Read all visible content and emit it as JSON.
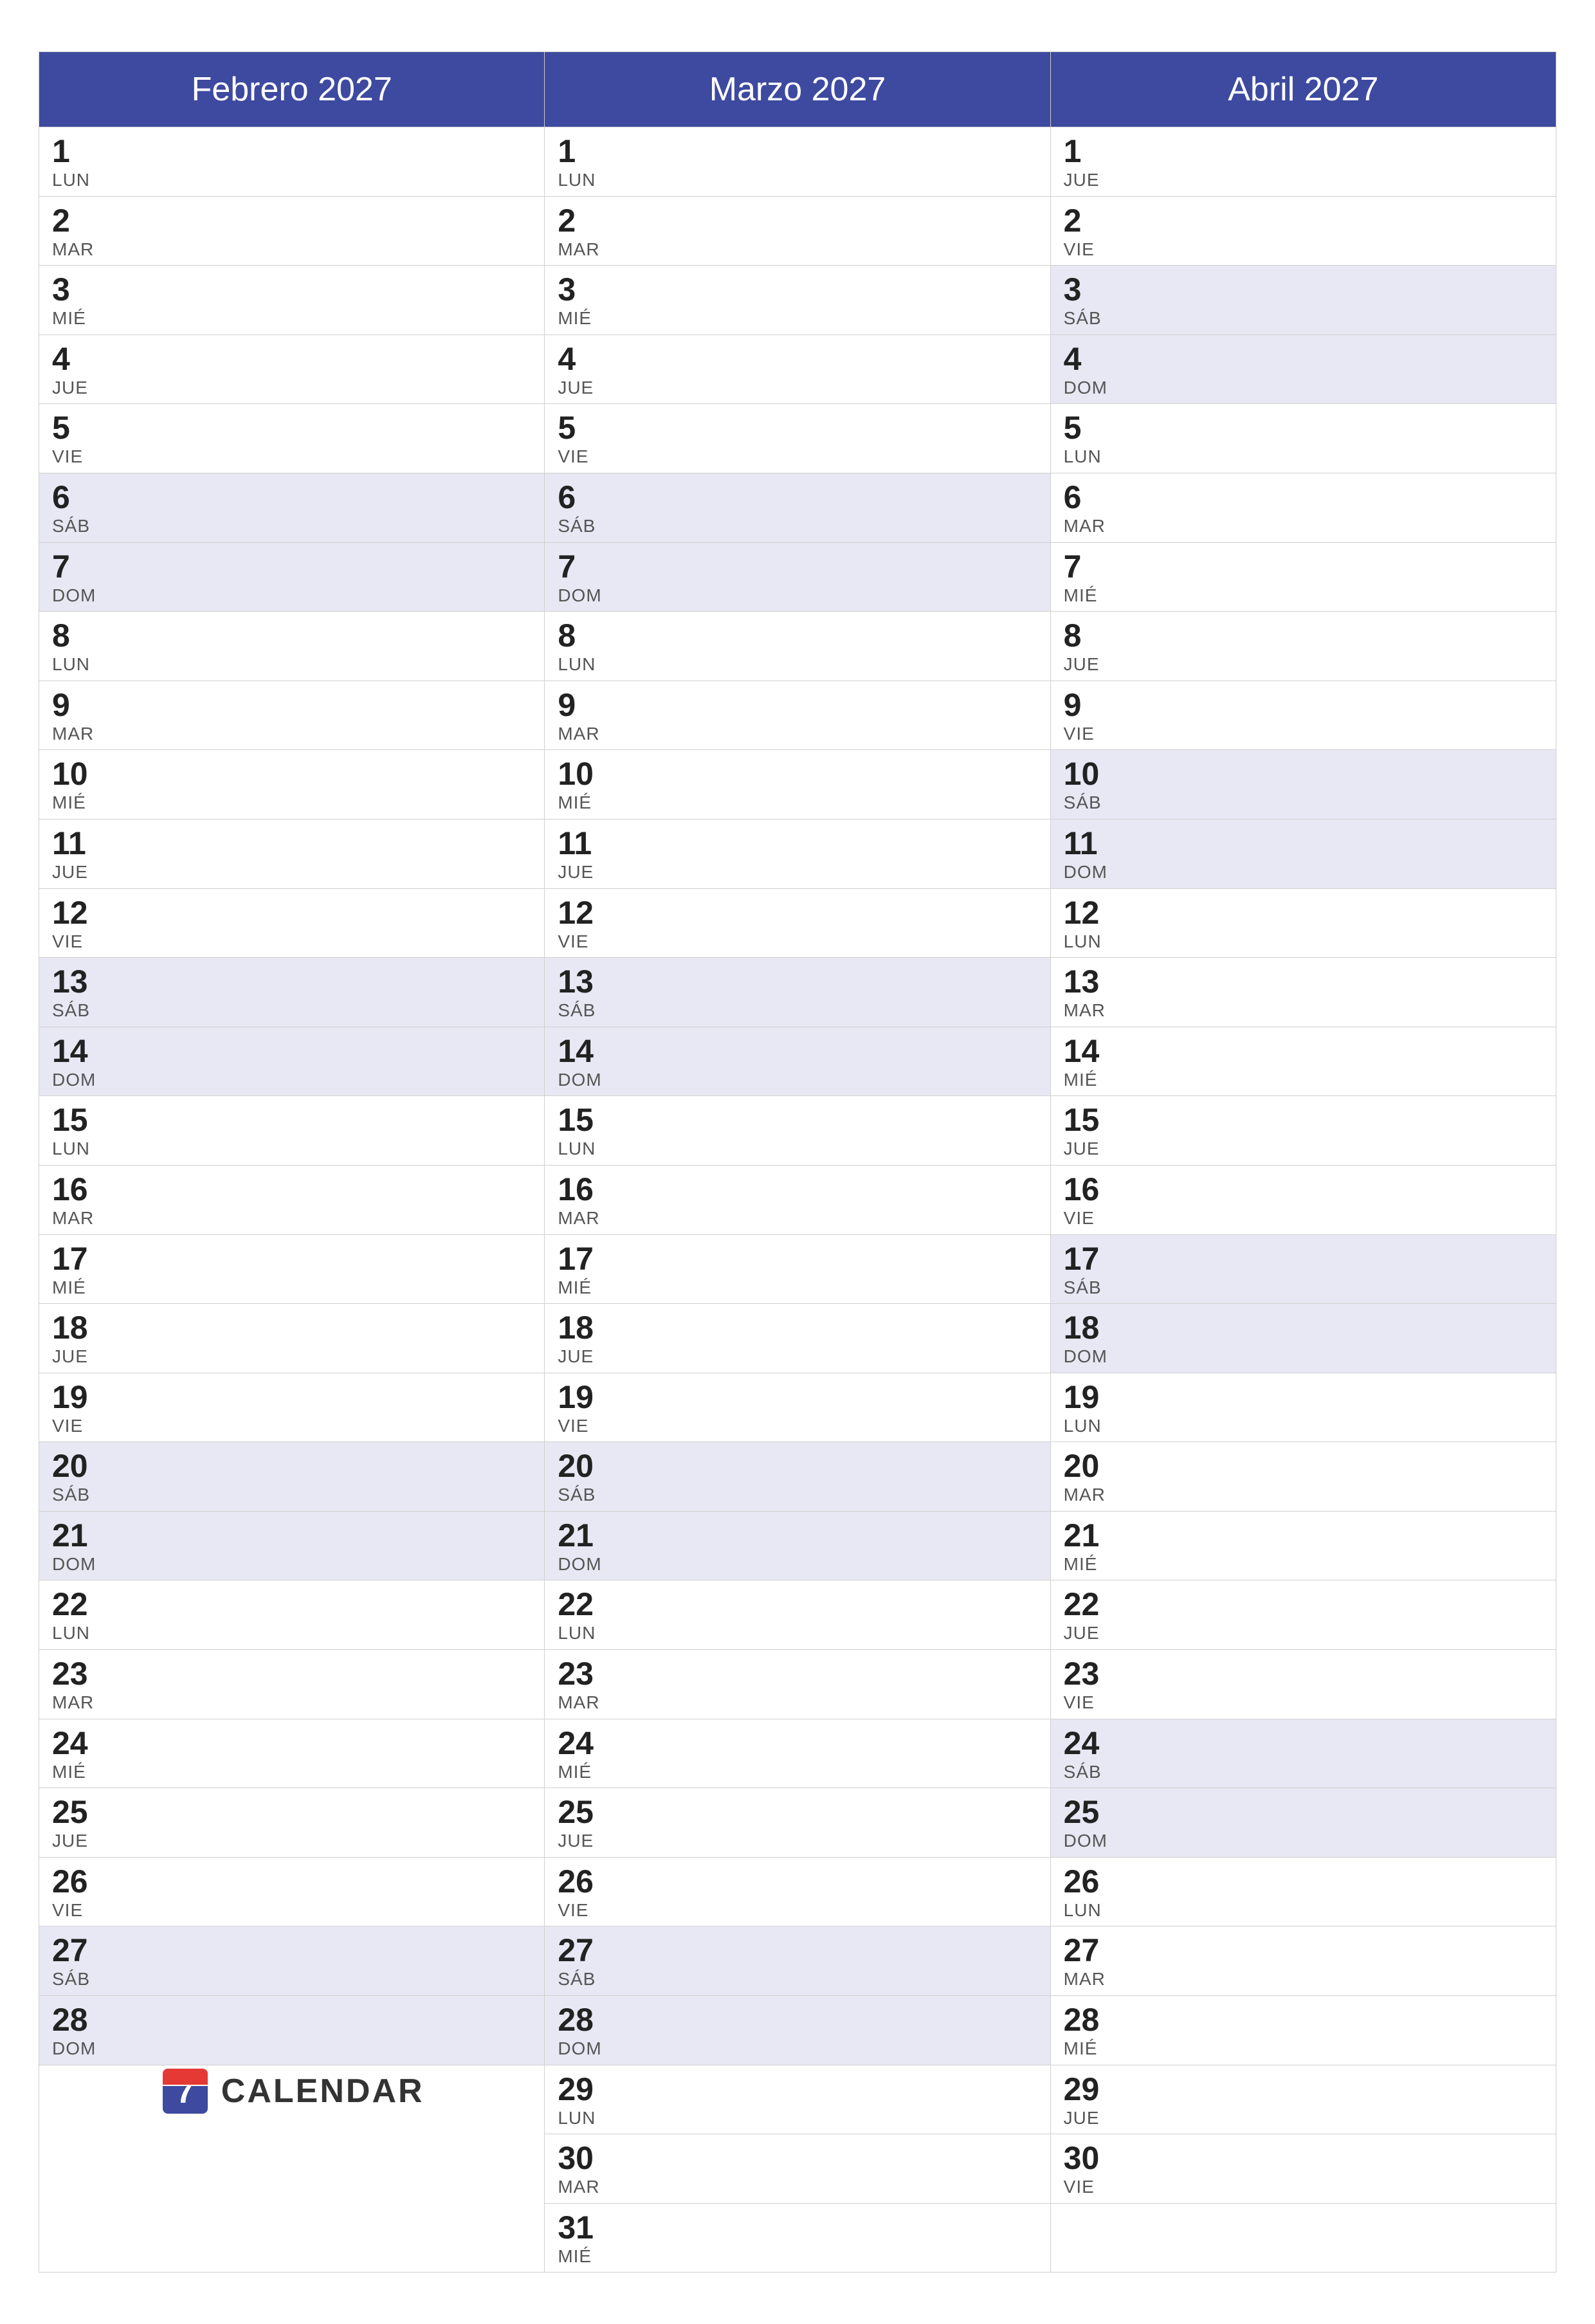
{
  "months": [
    {
      "name": "Febrero 2027",
      "days": [
        {
          "num": "1",
          "day": "LUN",
          "weekend": false
        },
        {
          "num": "2",
          "day": "MAR",
          "weekend": false
        },
        {
          "num": "3",
          "day": "MIÉ",
          "weekend": false
        },
        {
          "num": "4",
          "day": "JUE",
          "weekend": false
        },
        {
          "num": "5",
          "day": "VIE",
          "weekend": false
        },
        {
          "num": "6",
          "day": "SÁB",
          "weekend": true
        },
        {
          "num": "7",
          "day": "DOM",
          "weekend": true
        },
        {
          "num": "8",
          "day": "LUN",
          "weekend": false
        },
        {
          "num": "9",
          "day": "MAR",
          "weekend": false
        },
        {
          "num": "10",
          "day": "MIÉ",
          "weekend": false
        },
        {
          "num": "11",
          "day": "JUE",
          "weekend": false
        },
        {
          "num": "12",
          "day": "VIE",
          "weekend": false
        },
        {
          "num": "13",
          "day": "SÁB",
          "weekend": true
        },
        {
          "num": "14",
          "day": "DOM",
          "weekend": true
        },
        {
          "num": "15",
          "day": "LUN",
          "weekend": false
        },
        {
          "num": "16",
          "day": "MAR",
          "weekend": false
        },
        {
          "num": "17",
          "day": "MIÉ",
          "weekend": false
        },
        {
          "num": "18",
          "day": "JUE",
          "weekend": false
        },
        {
          "num": "19",
          "day": "VIE",
          "weekend": false
        },
        {
          "num": "20",
          "day": "SÁB",
          "weekend": true
        },
        {
          "num": "21",
          "day": "DOM",
          "weekend": true
        },
        {
          "num": "22",
          "day": "LUN",
          "weekend": false
        },
        {
          "num": "23",
          "day": "MAR",
          "weekend": false
        },
        {
          "num": "24",
          "day": "MIÉ",
          "weekend": false
        },
        {
          "num": "25",
          "day": "JUE",
          "weekend": false
        },
        {
          "num": "26",
          "day": "VIE",
          "weekend": false
        },
        {
          "num": "27",
          "day": "SÁB",
          "weekend": true
        },
        {
          "num": "28",
          "day": "DOM",
          "weekend": true
        }
      ]
    },
    {
      "name": "Marzo 2027",
      "days": [
        {
          "num": "1",
          "day": "LUN",
          "weekend": false
        },
        {
          "num": "2",
          "day": "MAR",
          "weekend": false
        },
        {
          "num": "3",
          "day": "MIÉ",
          "weekend": false
        },
        {
          "num": "4",
          "day": "JUE",
          "weekend": false
        },
        {
          "num": "5",
          "day": "VIE",
          "weekend": false
        },
        {
          "num": "6",
          "day": "SÁB",
          "weekend": true
        },
        {
          "num": "7",
          "day": "DOM",
          "weekend": true
        },
        {
          "num": "8",
          "day": "LUN",
          "weekend": false
        },
        {
          "num": "9",
          "day": "MAR",
          "weekend": false
        },
        {
          "num": "10",
          "day": "MIÉ",
          "weekend": false
        },
        {
          "num": "11",
          "day": "JUE",
          "weekend": false
        },
        {
          "num": "12",
          "day": "VIE",
          "weekend": false
        },
        {
          "num": "13",
          "day": "SÁB",
          "weekend": true
        },
        {
          "num": "14",
          "day": "DOM",
          "weekend": true
        },
        {
          "num": "15",
          "day": "LUN",
          "weekend": false
        },
        {
          "num": "16",
          "day": "MAR",
          "weekend": false
        },
        {
          "num": "17",
          "day": "MIÉ",
          "weekend": false
        },
        {
          "num": "18",
          "day": "JUE",
          "weekend": false
        },
        {
          "num": "19",
          "day": "VIE",
          "weekend": false
        },
        {
          "num": "20",
          "day": "SÁB",
          "weekend": true
        },
        {
          "num": "21",
          "day": "DOM",
          "weekend": true
        },
        {
          "num": "22",
          "day": "LUN",
          "weekend": false
        },
        {
          "num": "23",
          "day": "MAR",
          "weekend": false
        },
        {
          "num": "24",
          "day": "MIÉ",
          "weekend": false
        },
        {
          "num": "25",
          "day": "JUE",
          "weekend": false
        },
        {
          "num": "26",
          "day": "VIE",
          "weekend": false
        },
        {
          "num": "27",
          "day": "SÁB",
          "weekend": true
        },
        {
          "num": "28",
          "day": "DOM",
          "weekend": true
        },
        {
          "num": "29",
          "day": "LUN",
          "weekend": false
        },
        {
          "num": "30",
          "day": "MAR",
          "weekend": false
        },
        {
          "num": "31",
          "day": "MIÉ",
          "weekend": false
        }
      ]
    },
    {
      "name": "Abril 2027",
      "days": [
        {
          "num": "1",
          "day": "JUE",
          "weekend": false
        },
        {
          "num": "2",
          "day": "VIE",
          "weekend": false
        },
        {
          "num": "3",
          "day": "SÁB",
          "weekend": true
        },
        {
          "num": "4",
          "day": "DOM",
          "weekend": true
        },
        {
          "num": "5",
          "day": "LUN",
          "weekend": false
        },
        {
          "num": "6",
          "day": "MAR",
          "weekend": false
        },
        {
          "num": "7",
          "day": "MIÉ",
          "weekend": false
        },
        {
          "num": "8",
          "day": "JUE",
          "weekend": false
        },
        {
          "num": "9",
          "day": "VIE",
          "weekend": false
        },
        {
          "num": "10",
          "day": "SÁB",
          "weekend": true
        },
        {
          "num": "11",
          "day": "DOM",
          "weekend": true
        },
        {
          "num": "12",
          "day": "LUN",
          "weekend": false
        },
        {
          "num": "13",
          "day": "MAR",
          "weekend": false
        },
        {
          "num": "14",
          "day": "MIÉ",
          "weekend": false
        },
        {
          "num": "15",
          "day": "JUE",
          "weekend": false
        },
        {
          "num": "16",
          "day": "VIE",
          "weekend": false
        },
        {
          "num": "17",
          "day": "SÁB",
          "weekend": true
        },
        {
          "num": "18",
          "day": "DOM",
          "weekend": true
        },
        {
          "num": "19",
          "day": "LUN",
          "weekend": false
        },
        {
          "num": "20",
          "day": "MAR",
          "weekend": false
        },
        {
          "num": "21",
          "day": "MIÉ",
          "weekend": false
        },
        {
          "num": "22",
          "day": "JUE",
          "weekend": false
        },
        {
          "num": "23",
          "day": "VIE",
          "weekend": false
        },
        {
          "num": "24",
          "day": "SÁB",
          "weekend": true
        },
        {
          "num": "25",
          "day": "DOM",
          "weekend": true
        },
        {
          "num": "26",
          "day": "LUN",
          "weekend": false
        },
        {
          "num": "27",
          "day": "MAR",
          "weekend": false
        },
        {
          "num": "28",
          "day": "MIÉ",
          "weekend": false
        },
        {
          "num": "29",
          "day": "JUE",
          "weekend": false
        },
        {
          "num": "30",
          "day": "VIE",
          "weekend": false
        }
      ]
    }
  ],
  "logo": {
    "text": "CALENDAR",
    "icon_color_red": "#e53935",
    "icon_color_blue": "#3d4aa0"
  }
}
